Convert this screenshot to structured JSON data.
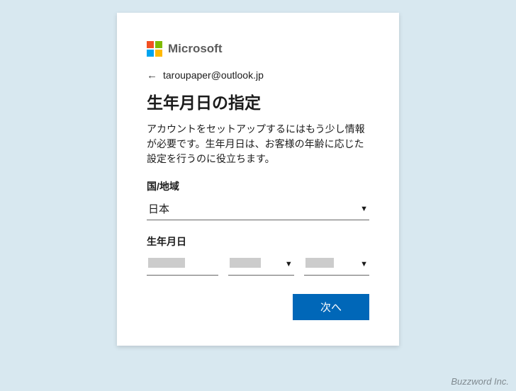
{
  "brand": {
    "name": "Microsoft"
  },
  "identity": {
    "email": "taroupaper@outlook.jp"
  },
  "page": {
    "title": "生年月日の指定",
    "description": "アカウントをセットアップするにはもう少し情報が必要です。生年月日は、お客様の年齢に応じた設定を行うのに役立ちます。"
  },
  "fields": {
    "country_label": "国/地域",
    "country_value": "日本",
    "dob_label": "生年月日"
  },
  "buttons": {
    "next": "次へ"
  },
  "watermark": "Buzzword Inc."
}
